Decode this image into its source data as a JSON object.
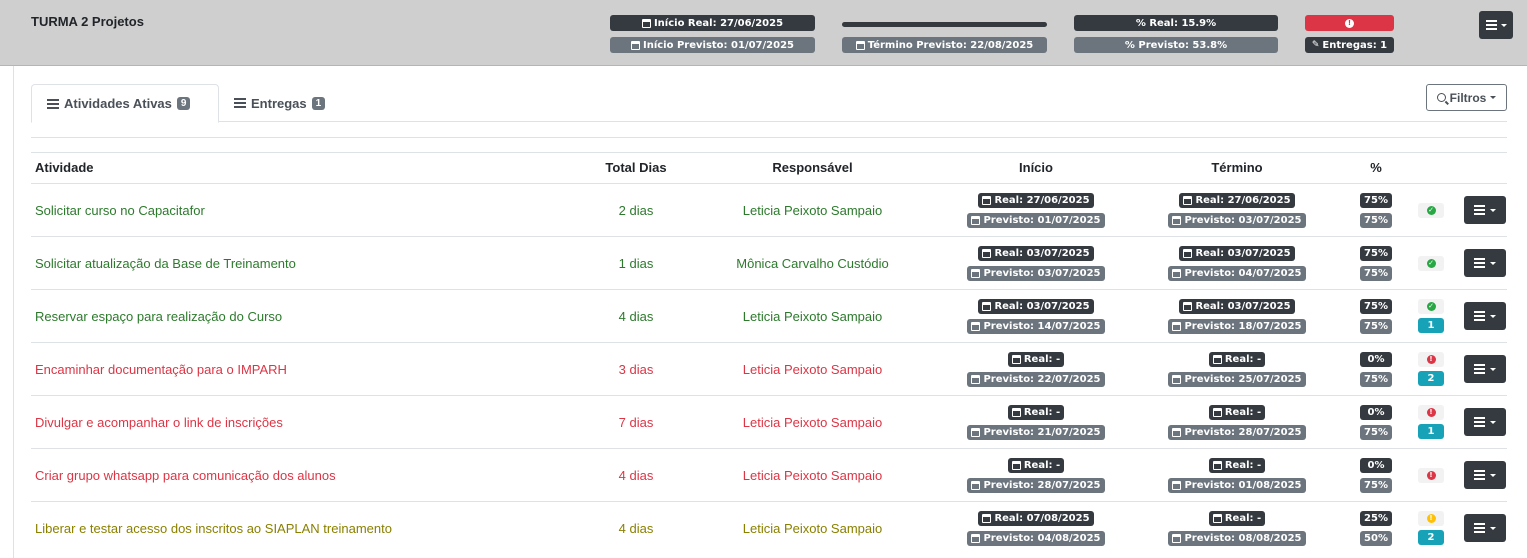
{
  "header": {
    "title": "TURMA 2 Projetos",
    "inicio_real": "Início Real: 27/06/2025",
    "inicio_previsto": "Início Previsto: 01/07/2025",
    "termino_previsto": "Término Previsto: 22/08/2025",
    "pct_real": "% Real: 15.9%",
    "pct_previsto": "% Previsto: 53.8%",
    "alert_icon": "exclamation-circle-icon",
    "entregas": "Entregas: 1",
    "progress_real_fraction": 1.0
  },
  "tabs": [
    {
      "label": "Atividades Ativas",
      "count": "9",
      "active": true
    },
    {
      "label": "Entregas",
      "count": "1",
      "active": false
    }
  ],
  "filters_label": "Filtros",
  "columns": {
    "activity": "Atividade",
    "total_days": "Total Dias",
    "responsible": "Responsável",
    "start": "Início",
    "end": "Término",
    "pct": "%"
  },
  "rows": [
    {
      "name": "Solicitar curso no Capacitafor",
      "days": "2 dias",
      "resp": "Leticia Peixoto Sampaio",
      "tone": "green",
      "start_real": "Real: 27/06/2025",
      "start_prev": "Previsto: 01/07/2025",
      "end_real": "Real: 27/06/2025",
      "end_prev": "Previsto: 03/07/2025",
      "pct_real": "75%",
      "pct_prev": "75%",
      "status": "ok",
      "badge": ""
    },
    {
      "name": "Solicitar atualização da Base de Treinamento",
      "days": "1 dias",
      "resp": "Mônica Carvalho Custódio",
      "tone": "green",
      "start_real": "Real: 03/07/2025",
      "start_prev": "Previsto: 03/07/2025",
      "end_real": "Real: 03/07/2025",
      "end_prev": "Previsto: 04/07/2025",
      "pct_real": "75%",
      "pct_prev": "75%",
      "status": "ok",
      "badge": ""
    },
    {
      "name": "Reservar espaço para realização do Curso",
      "days": "4 dias",
      "resp": "Leticia Peixoto Sampaio",
      "tone": "green",
      "start_real": "Real: 03/07/2025",
      "start_prev": "Previsto: 14/07/2025",
      "end_real": "Real: 03/07/2025",
      "end_prev": "Previsto: 18/07/2025",
      "pct_real": "75%",
      "pct_prev": "75%",
      "status": "ok",
      "badge": "1"
    },
    {
      "name": "Encaminhar documentação para o IMPARH",
      "days": "3 dias",
      "resp": "Leticia Peixoto Sampaio",
      "tone": "red",
      "start_real": "Real: -",
      "start_prev": "Previsto: 22/07/2025",
      "end_real": "Real: -",
      "end_prev": "Previsto: 25/07/2025",
      "pct_real": "0%",
      "pct_prev": "75%",
      "status": "err",
      "badge": "2"
    },
    {
      "name": "Divulgar e acompanhar o link de inscrições",
      "days": "7 dias",
      "resp": "Leticia Peixoto Sampaio",
      "tone": "red",
      "start_real": "Real: -",
      "start_prev": "Previsto: 21/07/2025",
      "end_real": "Real: -",
      "end_prev": "Previsto: 28/07/2025",
      "pct_real": "0%",
      "pct_prev": "75%",
      "status": "err",
      "badge": "1"
    },
    {
      "name": "Criar grupo whatsapp para comunicação dos alunos",
      "days": "4 dias",
      "resp": "Leticia Peixoto Sampaio",
      "tone": "red",
      "start_real": "Real: -",
      "start_prev": "Previsto: 28/07/2025",
      "end_real": "Real: -",
      "end_prev": "Previsto: 01/08/2025",
      "pct_real": "0%",
      "pct_prev": "75%",
      "status": "err",
      "badge": ""
    },
    {
      "name": "Liberar e testar acesso dos inscritos ao SIAPLAN treinamento",
      "days": "4 dias",
      "resp": "Leticia Peixoto Sampaio",
      "tone": "olive",
      "start_real": "Real: 07/08/2025",
      "start_prev": "Previsto: 04/08/2025",
      "end_real": "Real: -",
      "end_prev": "Previsto: 08/08/2025",
      "pct_real": "25%",
      "pct_prev": "50%",
      "status": "warn",
      "badge": "2"
    }
  ],
  "colors": {
    "green": "#2d7a2d",
    "red": "#dc3545",
    "olive": "#8a8000",
    "dark": "#343a40",
    "gray": "#6c757d",
    "teal": "#17a2b8"
  }
}
